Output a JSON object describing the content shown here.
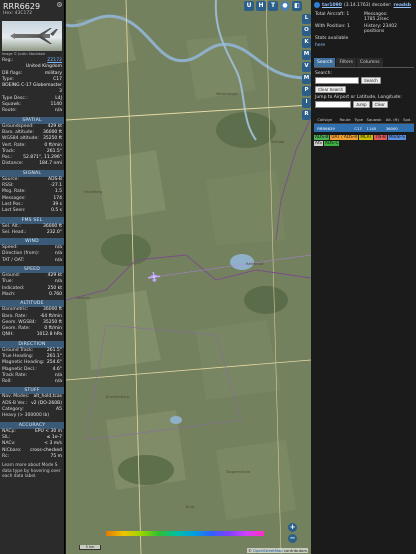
{
  "aircraft": {
    "callsign": "RRR6629",
    "hex": "Hex: 43C172",
    "photo_credit": "Image © Justin Stockdale",
    "info": [
      {
        "k": "Reg.:",
        "v": "ZZ172",
        "link": true
      },
      {
        "k": "",
        "v": "United Kingdom"
      },
      {
        "k": "DB flags:",
        "v": "military"
      },
      {
        "k": "Type:",
        "v": "C17"
      },
      {
        "k": "",
        "v": "BOEING C-17 Globemaster 3"
      },
      {
        "k": "Type Desc.:",
        "v": "L4J"
      },
      {
        "k": "Squawk:",
        "v": "1140"
      },
      {
        "k": "Route:",
        "v": "n/a"
      }
    ]
  },
  "sections": [
    {
      "title": "SPATIAL",
      "rows": [
        {
          "k": "Groundspeed:",
          "v": "429 kt"
        },
        {
          "k": "Baro. altitude:",
          "v": "36000 ft"
        },
        {
          "k": "WGS84 altitude:",
          "v": "35250 ft"
        },
        {
          "k": "Vert. Rate:",
          "v": "0 ft/min"
        },
        {
          "k": "Track:",
          "v": "261.5°"
        },
        {
          "k": "Pos.:",
          "v": "52.871°, 11.296°"
        },
        {
          "k": "Distance:",
          "v": "184.7 nmi"
        }
      ]
    },
    {
      "title": "SIGNAL",
      "rows": [
        {
          "k": "Source:",
          "v": "ADS-B"
        },
        {
          "k": "RSSI:",
          "v": "-27.1"
        },
        {
          "k": "Msg. Rate:",
          "v": "1.5"
        },
        {
          "k": "Messages:",
          "v": "174"
        },
        {
          "k": "Last Pos.:",
          "v": "39 s"
        },
        {
          "k": "Last Seen:",
          "v": "0.5 s"
        }
      ]
    },
    {
      "title": "FMS SEL",
      "rows": [
        {
          "k": "Sel. Alt.:",
          "v": "36000 ft"
        },
        {
          "k": "Sel. Head.:",
          "v": "232.0°"
        }
      ]
    },
    {
      "title": "WIND",
      "rows": [
        {
          "k": "Speed:",
          "v": "n/a"
        },
        {
          "k": "Direction (from):",
          "v": "n/a"
        },
        {
          "k": "TAT / OAT:",
          "v": "n/a"
        }
      ]
    },
    {
      "title": "SPEED",
      "rows": [
        {
          "k": "Ground:",
          "v": "429 kt"
        },
        {
          "k": "True:",
          "v": "n/a"
        },
        {
          "k": "Indicated:",
          "v": "250 kt"
        },
        {
          "k": "Mach:",
          "v": "0.760"
        }
      ]
    },
    {
      "title": "ALTITUDE",
      "rows": [
        {
          "k": "Barometric:",
          "v": "36000 ft"
        },
        {
          "k": "Baro. Rate:",
          "v": "-64 ft/min"
        },
        {
          "k": "Geom. WGS84:",
          "v": "35250 ft"
        },
        {
          "k": "Geom. Rate:",
          "v": "0 ft/min"
        },
        {
          "k": "QNH:",
          "v": "1012.8 hPa"
        }
      ]
    },
    {
      "title": "DIRECTION",
      "rows": [
        {
          "k": "Ground Track:",
          "v": "261.5°"
        },
        {
          "k": "True Heading:",
          "v": "261.1°"
        },
        {
          "k": "Magnetic Heading:",
          "v": "254.6°"
        },
        {
          "k": "Magnetic Decl.:",
          "v": "4.6°"
        },
        {
          "k": "Track Rate:",
          "v": "n/a"
        },
        {
          "k": "Roll:",
          "v": "n/a"
        }
      ]
    },
    {
      "title": "STUFF",
      "rows": [
        {
          "k": "Nav. Modes:",
          "v": "alt_hold,tcas"
        },
        {
          "k": "ADS-B Ver.:",
          "v": "v2 (DO-260B)"
        },
        {
          "k": "Category:",
          "v": "A5"
        },
        {
          "k": "Heavy (> 300000 lb)",
          "v": ""
        }
      ]
    },
    {
      "title": "ACCURACY",
      "rows": [
        {
          "k": "NACp:",
          "v": "EPU < 30 m"
        },
        {
          "k": "SIL:",
          "v": "≤ 1e-7"
        },
        {
          "k": "NACv:",
          "v": "< 3 m/s"
        },
        {
          "k": "NICbaro:",
          "v": "cross-checked"
        },
        {
          "k": "Rc:",
          "v": "75 m"
        }
      ]
    }
  ],
  "footer_note": "Learn more about Mode S data type by hovering over each data label.",
  "map": {
    "top_buttons": [
      "U",
      "H",
      "T"
    ],
    "side_buttons": [
      "L",
      "O",
      "K",
      "M",
      "V",
      "M",
      "P",
      "I",
      "R"
    ],
    "zoom_in": "+",
    "zoom_out": "−",
    "scale_label": "5 km",
    "alt_labels": [
      "",
      "",
      "",
      "",
      "",
      "",
      ""
    ],
    "attribution_prefix": "© ",
    "attribution_link": "OpenStreetMap",
    "attribution_suffix": " contributors",
    "places": [
      "Wittenberge",
      "Havelberg",
      "Rathenow",
      "Genthin",
      "Stendal",
      "Tangermünde",
      "Brandenburg",
      "Burg"
    ]
  },
  "right_panel": {
    "site_link": "tar1090",
    "version_text": "(3.14.1763) decoder:",
    "decoder_link": "readsb",
    "stats": [
      "Total Aircraft: 1",
      "Messages: 1785.2/sec",
      "With Position: 1",
      "History: 23402 positions"
    ],
    "stats_available": "Stats available",
    "stats_link": "here",
    "tabs": [
      "Search",
      "Filters",
      "Columns"
    ],
    "search_label": "Search:",
    "search_button": "Search",
    "clear_search_button": "Clear Search",
    "jump_label": "Jump to Airport or Latitude, Longitude:",
    "jump_button": "Jump",
    "clear_button": "Clear",
    "table_headers": [
      "",
      "Callsign",
      "Route",
      "Type",
      "Squawk",
      "Alt. (ft)",
      "Spd."
    ],
    "table_rows": [
      [
        "",
        "RRR6629",
        "",
        "C17",
        "1140",
        "36000",
        ""
      ]
    ],
    "legend": [
      {
        "label": "ADS-B",
        "color": "#4caf50"
      },
      {
        "label": "UAT / ADS-R",
        "color": "#f0a030"
      },
      {
        "label": "MLAT",
        "color": "#c8c000"
      },
      {
        "label": "TIS-B",
        "color": "#e05a5a"
      },
      {
        "label": "Mode-S",
        "color": "#5a8fe0"
      },
      {
        "label": "AIS",
        "color": "#cccccc"
      },
      {
        "label": "ADS-C",
        "color": "#3caf3c"
      }
    ]
  }
}
